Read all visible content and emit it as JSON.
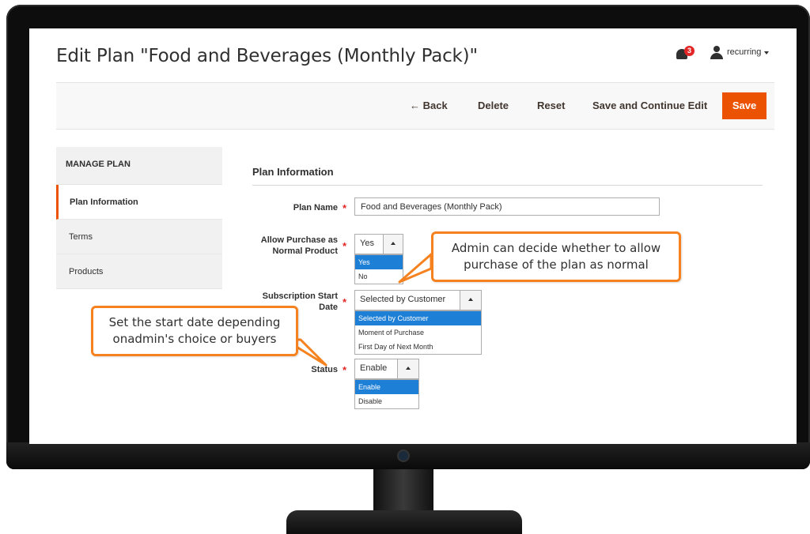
{
  "header": {
    "title": "Edit Plan \"Food and Beverages (Monthly Pack)\"",
    "notification_count": "3",
    "user_name": "recurring"
  },
  "toolbar": {
    "back_label": "← Back",
    "delete_label": "Delete",
    "reset_label": "Reset",
    "save_continue_label": "Save and Continue Edit",
    "save_label": "Save",
    "save_color": "#eb5202"
  },
  "sidebar": {
    "heading": "MANAGE PLAN",
    "items": [
      {
        "label": "Plan Information",
        "active": true
      },
      {
        "label": "Terms",
        "active": false
      },
      {
        "label": "Products",
        "active": false
      }
    ]
  },
  "form": {
    "section_title": "Plan Information",
    "plan_name": {
      "label": "Plan Name",
      "value": "Food and Beverages (Monthly Pack)"
    },
    "allow_purchase": {
      "label_line1": "Allow Purchase as",
      "label_line2": "Normal Product",
      "value": "Yes",
      "options": [
        "Yes",
        "No"
      ],
      "selected_index": 0
    },
    "subscription_start": {
      "label_line1": "Subscription Start",
      "label_line2": "Date",
      "value": "Selected by Customer",
      "options": [
        "Selected by Customer",
        "Moment of Purchase",
        "First Day of Next Month"
      ],
      "selected_index": 0
    },
    "status": {
      "label": "Status",
      "value": "Enable",
      "options": [
        "Enable",
        "Disable"
      ],
      "selected_index": 0
    },
    "required_mark": "*"
  },
  "callouts": {
    "allow_purchase_note_line1": "Admin can decide whether to allow",
    "allow_purchase_note_line2": "purchase of the plan as normal",
    "start_date_note_line1": "Set the start date depending",
    "start_date_note_line2": "onadmin's choice or buyers",
    "border_color": "#f5821f"
  }
}
